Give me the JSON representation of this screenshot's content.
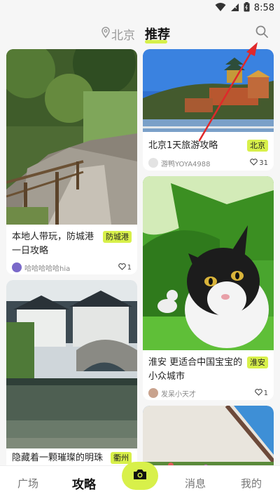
{
  "status": {
    "time": "8:58"
  },
  "header": {
    "location": "北京",
    "tab_recommend": "推荐",
    "accent": "#d8f04a"
  },
  "cards": [
    {
      "title": "本地人带玩，防城港一日攻略",
      "tag": "防城港",
      "author": "哈哈哈哈哈hia",
      "likes": "1"
    },
    {
      "title": "北京1天旅游攻略",
      "tag": "北京",
      "author": "游鸭YOYA4988",
      "likes": "31"
    },
    {
      "title": "淮安 更适合中国宝宝的小众城市",
      "tag": "淮安",
      "author": "发呆小天才",
      "likes": "1"
    },
    {
      "title": "隐藏着一颗璀璨的明珠——",
      "tag": "衢州"
    }
  ],
  "nav": {
    "square": "广场",
    "guide": "攻略",
    "messages": "消息",
    "mine": "我的"
  }
}
